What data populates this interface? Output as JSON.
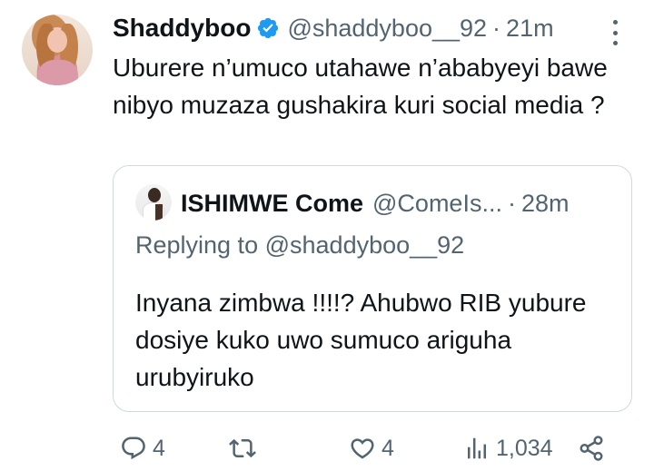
{
  "tweet": {
    "display_name": "Shaddyboo",
    "handle": "@shaddyboo__92",
    "separator": "·",
    "time": "21m",
    "text": "Uburere n’umuco utahawe n’ababyeyi bawe nibyo muzaza gushakira kuri social media ?",
    "verified": true,
    "verified_color": "#1d9bf0"
  },
  "quote": {
    "display_name": "ISHIMWE Come",
    "handle": "@ComeIs...",
    "separator": "·",
    "time": "28m",
    "replying_prefix": "Replying to",
    "replying_handle": "@shaddyboo__92",
    "text": "Inyana zimbwa !!!!? Ahubwo RIB yubure dosiye kuko uwo sumuco ariguha urubyiruko"
  },
  "actions": {
    "reply_count": "4",
    "retweet_count": "",
    "like_count": "4",
    "views_count": "1,034"
  },
  "icons": [
    "more-icon",
    "verified-badge-icon",
    "reply-icon",
    "retweet-icon",
    "like-icon",
    "views-icon",
    "share-icon"
  ],
  "colors": {
    "text_primary": "#0f1419",
    "text_secondary": "#536471",
    "border": "#cfd9de",
    "verified": "#1d9bf0"
  }
}
